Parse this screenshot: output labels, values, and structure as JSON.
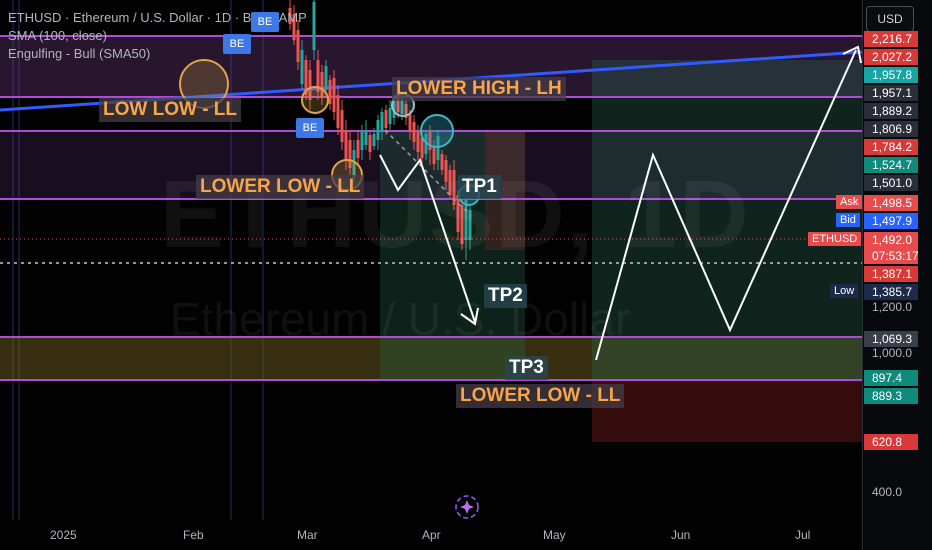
{
  "legend": {
    "symbol_line": "ETHUSD · Ethereum / U.S. Dollar · 1D · BITSTAMP",
    "sma_line": "SMA (100, close)",
    "pattern_line": "Engulfing - Bull (SMA50)"
  },
  "watermark": {
    "symbol": "ETHUSD, 1D",
    "name": "Ethereum / U.S. Dollar"
  },
  "annotations": {
    "low_low": "LOW LOW - LL",
    "lower_high": "LOWER HIGH - LH",
    "lower_low_1": "LOWER LOW - LL",
    "lower_low_2": "LOWER LOW - LL",
    "tp1": "TP1",
    "tp2": "TP2",
    "tp3": "TP3",
    "be": "BE"
  },
  "axis": {
    "currency": "USD",
    "tags": [
      {
        "value": "2,216.7",
        "color": "#d83a3a"
      },
      {
        "value": "2,027.2",
        "color": "#d83a3a"
      },
      {
        "value": "1,957.8",
        "color": "#16a5a5"
      },
      {
        "value": "1,957.1",
        "color": "#2a2e39"
      },
      {
        "value": "1,889.2",
        "color": "#2a2e39"
      },
      {
        "value": "1,806.9",
        "color": "#2a2e39"
      },
      {
        "value": "1,784.2",
        "color": "#d83a3a"
      },
      {
        "value": "1,524.7",
        "color": "#0f8a7c"
      },
      {
        "value": "1,501.0",
        "color": "#2a2e39"
      },
      {
        "value": "1,498.5",
        "color": "#e84b4b"
      },
      {
        "value": "1,497.9",
        "color": "#2962ff"
      },
      {
        "value": "1,492.0",
        "color": "#e84b4b"
      },
      {
        "value": "07:53:17",
        "color": "#e84b4b"
      },
      {
        "value": "1,387.1",
        "color": "#d83a3a"
      },
      {
        "value": "1,385.7",
        "color": "#1e2a4a"
      },
      {
        "value": "1,069.3",
        "color": "#3a3f4a"
      },
      {
        "value": "897.4",
        "color": "#0f8a7c"
      },
      {
        "value": "889.3",
        "color": "#0f8a7c"
      },
      {
        "value": "620.8",
        "color": "#d83a3a"
      }
    ],
    "ticks": [
      "1,200.0",
      "1,000.0",
      "400.0"
    ],
    "side_labels": {
      "ask": "Ask",
      "bid": "Bid",
      "symbol": "ETHUSD",
      "low": "Low"
    }
  },
  "dates": [
    "2025",
    "Feb",
    "Mar",
    "Apr",
    "May",
    "Jun",
    "Jul"
  ],
  "colors": {
    "horizontal_line": "#b04ad8",
    "trendline": "#2f5bff",
    "orange_label": "#f7a54a",
    "up_candle": "#26a69a",
    "down_candle": "#ef5350"
  }
}
